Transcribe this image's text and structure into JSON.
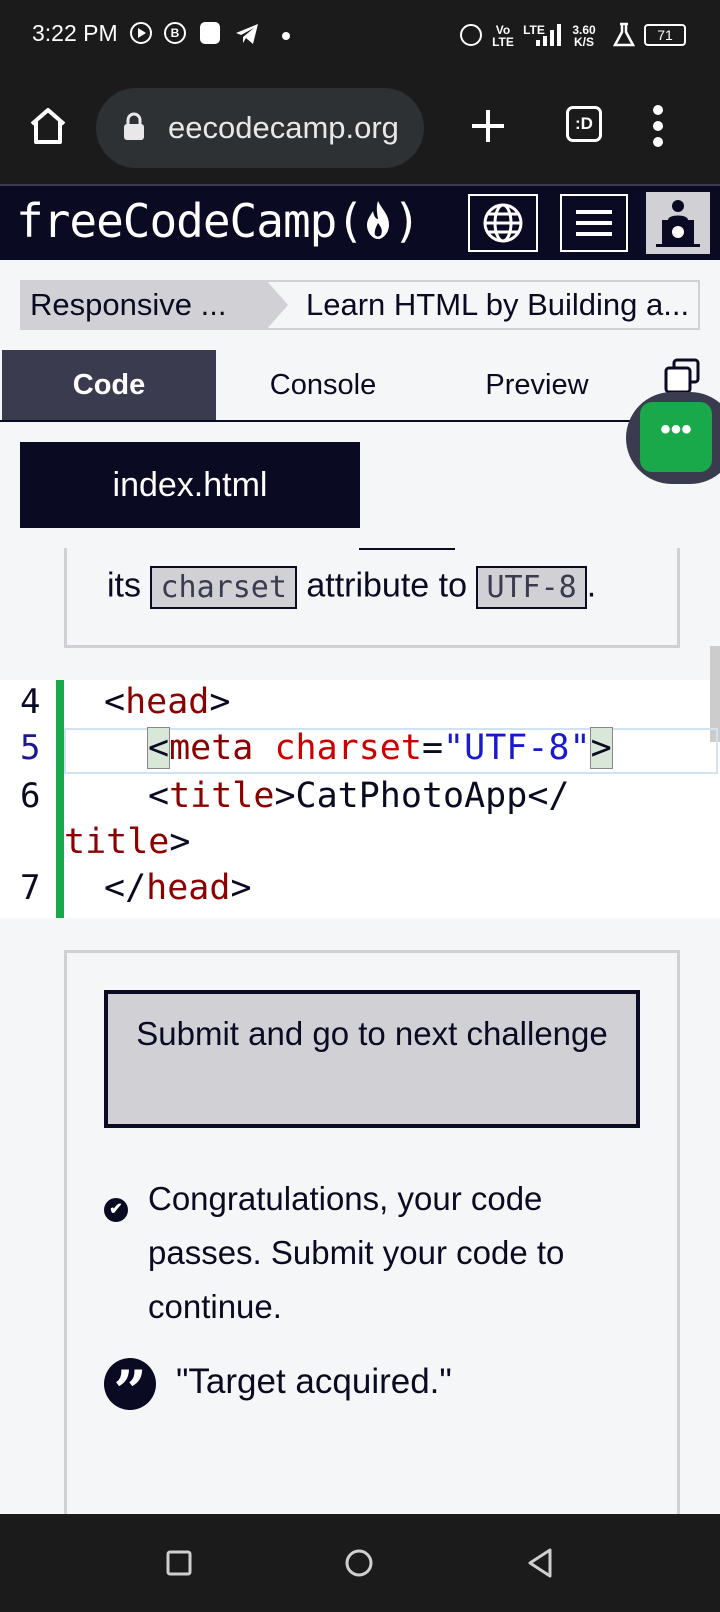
{
  "status_bar": {
    "time": "3:22 PM",
    "network_label_top": "Vo",
    "network_label_bottom": "LTE",
    "lte_label": "LTE",
    "speed_value": "3.60",
    "speed_unit": "K/S",
    "battery": "71"
  },
  "browser": {
    "url": "eecodecamp.org",
    "tab_count": ":D"
  },
  "fcc_nav": {
    "logo_text": "freeCodeCamp(",
    "logo_close": ")"
  },
  "breadcrumb": {
    "superblock": "Responsive ...",
    "block": "Learn HTML by Building a..."
  },
  "tabs": {
    "code": "Code",
    "console": "Console",
    "preview": "Preview"
  },
  "floating_button": {
    "label": "•••"
  },
  "file_tab": {
    "name": "index.html"
  },
  "instructions": {
    "prefix": "its ",
    "attr_code": "charset",
    "middle": " attribute to ",
    "value_code": "UTF-8",
    "suffix": "."
  },
  "editor": {
    "line_numbers": [
      "4",
      "5",
      "6",
      "7"
    ],
    "line4_open": "<",
    "line4_tag": "head",
    "line4_close": ">",
    "line5_lt": "<",
    "line5_tag": "meta",
    "line5_attr": "charset",
    "line5_eq": "=",
    "line5_value": "\"UTF-8\"",
    "line5_gt": ">",
    "line6_lt": "<",
    "line6_tag": "title",
    "line6_gt": ">",
    "line6_text": "CatPhotoApp",
    "line6_close_start": "</",
    "line6_close_tag": "title",
    "line6_close_gt": ">",
    "line7_lt": "</",
    "line7_tag": "head",
    "line7_gt": ">"
  },
  "lower": {
    "submit_label": "Submit and go to next challenge",
    "success_message": "Congratulations, your code passes. Submit your code to continue.",
    "success_icon": "✔",
    "quote": "\"Target acquired.\"",
    "quote_icon": "”"
  },
  "icons": {
    "home": "home-icon",
    "lock": "lock-icon",
    "plus": "plus-icon",
    "menu": "more-vert-icon",
    "globe": "globe-icon",
    "hamburger": "hamburger-icon",
    "avatar": "avatar-icon",
    "copy": "copy-icon"
  },
  "colors": {
    "fcc_dark": "#0a0a23",
    "gray_panel": "#3b3b4f",
    "success_green": "#19a84a",
    "light_gray": "#d0d0d5"
  }
}
